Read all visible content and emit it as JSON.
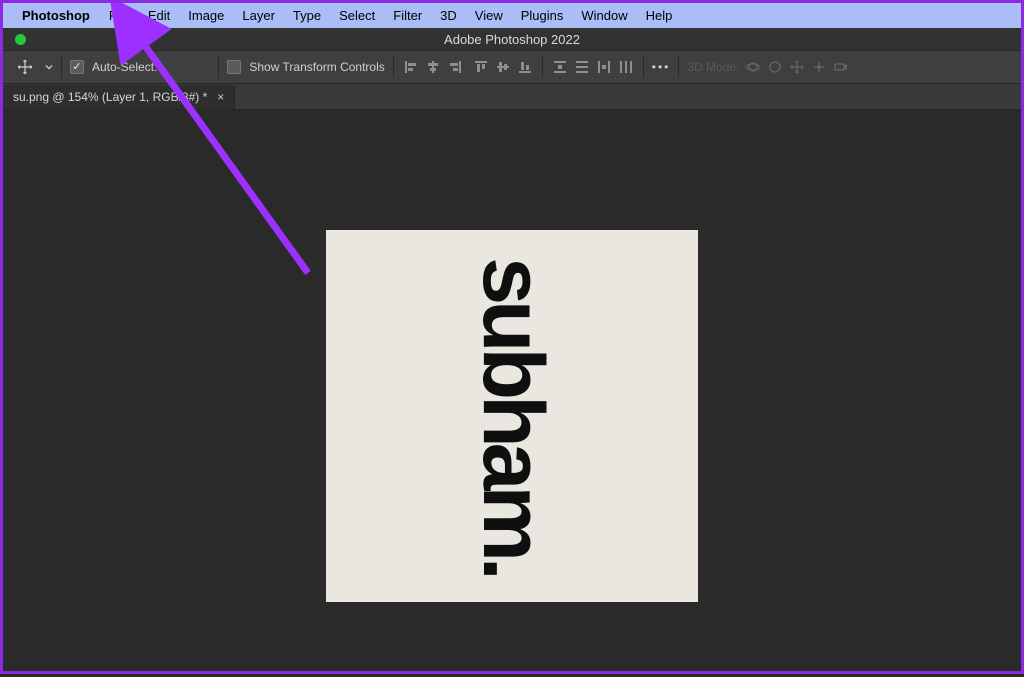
{
  "menubar": {
    "app": "Photoshop",
    "items": [
      "File",
      "Edit",
      "Image",
      "Layer",
      "Type",
      "Select",
      "Filter",
      "3D",
      "View",
      "Plugins",
      "Window",
      "Help"
    ]
  },
  "titlebar": {
    "title": "Adobe Photoshop 2022"
  },
  "options": {
    "auto_select": "Auto-Select:",
    "show_transform": "Show Transform Controls",
    "mode3d_label": "3D Mode:"
  },
  "tab": {
    "label": "su.png @ 154% (Layer 1, RGB/8#) *",
    "close": "×"
  },
  "canvas": {
    "text": "subham."
  }
}
